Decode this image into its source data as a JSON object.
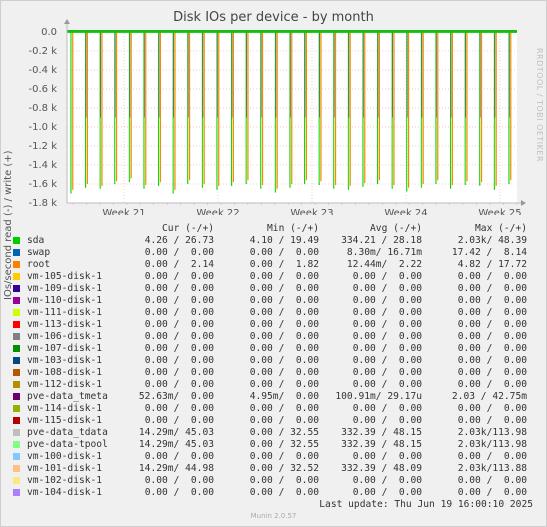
{
  "chart_data": {
    "type": "line",
    "title": "Disk IOs per device - by month",
    "ylabel": "IOs/second read (-) / write (+)",
    "yticks": [
      "0.0",
      "-0.2 k",
      "-0.4 k",
      "-0.6 k",
      "-0.8 k",
      "-1.0 k",
      "-1.2 k",
      "-1.4 k",
      "-1.6 k",
      "-1.8 k"
    ],
    "ylim": [
      -1800,
      20
    ],
    "xticks": [
      "Week 21",
      "Week 22",
      "Week 23",
      "Week 24",
      "Week 25"
    ],
    "spike_series": [
      {
        "name": "sda",
        "color": "#00cc00",
        "values": [
          -1700,
          -1640,
          -1650,
          -1600,
          -1580,
          -1650,
          -1620,
          -1700,
          -1600,
          -1640,
          -1660,
          -1620,
          -1600,
          -1650,
          -1690,
          -1640,
          -1600,
          -1610,
          -1650,
          -1660,
          -1630,
          -1600,
          -1650,
          -1680,
          -1640,
          -1600,
          -1650,
          -1610,
          -1620,
          -1660,
          -1600
        ]
      },
      {
        "name": "pve-data_tdata",
        "color": "#ccff99",
        "values": [
          -1680,
          -1620,
          -1640,
          -1590,
          -1560,
          -1630,
          -1600,
          -1680,
          -1580,
          -1620,
          -1640,
          -1600,
          -1580,
          -1630,
          -1670,
          -1620,
          -1580,
          -1590,
          -1630,
          -1640,
          -1610,
          -1580,
          -1630,
          -1660,
          -1620,
          -1580,
          -1630,
          -1590,
          -1600,
          -1640,
          -1580
        ]
      },
      {
        "name": "root",
        "color": "#ff8000",
        "values": [
          -1660,
          -1600,
          -1620,
          -1570,
          -1540,
          -1610,
          -1580,
          -1660,
          -1560,
          -1600,
          -1620,
          -1580,
          -1560,
          -1610,
          -1650,
          -1600,
          -1560,
          -1570,
          -1610,
          -1620,
          -1590,
          -1560,
          -1610,
          -1640,
          -1600,
          -1560,
          -1610,
          -1570,
          -1580,
          -1620,
          -1560
        ]
      }
    ],
    "minor_dip_level": -900,
    "legend_headers": {
      "cur": "Cur (-/+)",
      "min": "Min (-/+)",
      "avg": "Avg (-/+)",
      "max": "Max (-/+)"
    },
    "legend": [
      {
        "name": "sda",
        "color": "#00cc00",
        "cur": "4.26 / 26.73",
        "min": "4.10 / 19.49",
        "avg": "334.21 / 28.18",
        "max": "2.03k/ 48.39"
      },
      {
        "name": "swap",
        "color": "#0066b3",
        "cur": "0.00 /  0.00",
        "min": "0.00 /  0.00",
        "avg": "8.30m/ 16.71m",
        "max": "17.42 /  8.14"
      },
      {
        "name": "root",
        "color": "#ff8000",
        "cur": "0.00 /  2.14",
        "min": "0.00 /  1.82",
        "avg": "12.44m/  2.22",
        "max": "4.82 / 17.72"
      },
      {
        "name": "vm-105-disk-1",
        "color": "#ffcc00",
        "cur": "0.00 /  0.00",
        "min": "0.00 /  0.00",
        "avg": "0.00 /  0.00",
        "max": "0.00 /  0.00"
      },
      {
        "name": "vm-109-disk-1",
        "color": "#330099",
        "cur": "0.00 /  0.00",
        "min": "0.00 /  0.00",
        "avg": "0.00 /  0.00",
        "max": "0.00 /  0.00"
      },
      {
        "name": "vm-110-disk-1",
        "color": "#990099",
        "cur": "0.00 /  0.00",
        "min": "0.00 /  0.00",
        "avg": "0.00 /  0.00",
        "max": "0.00 /  0.00"
      },
      {
        "name": "vm-111-disk-1",
        "color": "#ccff00",
        "cur": "0.00 /  0.00",
        "min": "0.00 /  0.00",
        "avg": "0.00 /  0.00",
        "max": "0.00 /  0.00"
      },
      {
        "name": "vm-113-disk-1",
        "color": "#ff0000",
        "cur": "0.00 /  0.00",
        "min": "0.00 /  0.00",
        "avg": "0.00 /  0.00",
        "max": "0.00 /  0.00"
      },
      {
        "name": "vm-106-disk-1",
        "color": "#808080",
        "cur": "0.00 /  0.00",
        "min": "0.00 /  0.00",
        "avg": "0.00 /  0.00",
        "max": "0.00 /  0.00"
      },
      {
        "name": "vm-107-disk-1",
        "color": "#008f00",
        "cur": "0.00 /  0.00",
        "min": "0.00 /  0.00",
        "avg": "0.00 /  0.00",
        "max": "0.00 /  0.00"
      },
      {
        "name": "vm-103-disk-1",
        "color": "#00487d",
        "cur": "0.00 /  0.00",
        "min": "0.00 /  0.00",
        "avg": "0.00 /  0.00",
        "max": "0.00 /  0.00"
      },
      {
        "name": "vm-108-disk-1",
        "color": "#b35a00",
        "cur": "0.00 /  0.00",
        "min": "0.00 /  0.00",
        "avg": "0.00 /  0.00",
        "max": "0.00 /  0.00"
      },
      {
        "name": "vm-112-disk-1",
        "color": "#b38f00",
        "cur": "0.00 /  0.00",
        "min": "0.00 /  0.00",
        "avg": "0.00 /  0.00",
        "max": "0.00 /  0.00"
      },
      {
        "name": "pve-data_tmeta",
        "color": "#6b006b",
        "cur": "52.63m/  0.00",
        "min": "4.95m/  0.00",
        "avg": "100.91m/ 29.17u",
        "max": "2.03 / 42.75m"
      },
      {
        "name": "vm-114-disk-1",
        "color": "#8fb300",
        "cur": "0.00 /  0.00",
        "min": "0.00 /  0.00",
        "avg": "0.00 /  0.00",
        "max": "0.00 /  0.00"
      },
      {
        "name": "vm-115-disk-1",
        "color": "#b30000",
        "cur": "0.00 /  0.00",
        "min": "0.00 /  0.00",
        "avg": "0.00 /  0.00",
        "max": "0.00 /  0.00"
      },
      {
        "name": "pve-data_tdata",
        "color": "#bebebe",
        "cur": "14.29m/ 45.03",
        "min": "0.00 / 32.55",
        "avg": "332.39 / 48.15",
        "max": "2.03k/113.98"
      },
      {
        "name": "pve-data-tpool",
        "color": "#80ff80",
        "cur": "14.29m/ 45.03",
        "min": "0.00 / 32.55",
        "avg": "332.39 / 48.15",
        "max": "2.03k/113.98"
      },
      {
        "name": "vm-100-disk-1",
        "color": "#80c9ff",
        "cur": "0.00 /  0.00",
        "min": "0.00 /  0.00",
        "avg": "0.00 /  0.00",
        "max": "0.00 /  0.00"
      },
      {
        "name": "vm-101-disk-1",
        "color": "#ffc080",
        "cur": "14.29m/ 44.98",
        "min": "0.00 / 32.52",
        "avg": "332.39 / 48.09",
        "max": "2.03k/113.88"
      },
      {
        "name": "vm-102-disk-1",
        "color": "#ffe680",
        "cur": "0.00 /  0.00",
        "min": "0.00 /  0.00",
        "avg": "0.00 /  0.00",
        "max": "0.00 /  0.00"
      },
      {
        "name": "vm-104-disk-1",
        "color": "#aa80ff",
        "cur": "0.00 /  0.00",
        "min": "0.00 /  0.00",
        "avg": "0.00 /  0.00",
        "max": "0.00 /  0.00"
      }
    ]
  },
  "last_update": "Last update: Thu Jun 19 16:00:10 2025",
  "side_credit": "RRDTOOL / TOBI OETIKER",
  "version": "Munin 2.0.57"
}
